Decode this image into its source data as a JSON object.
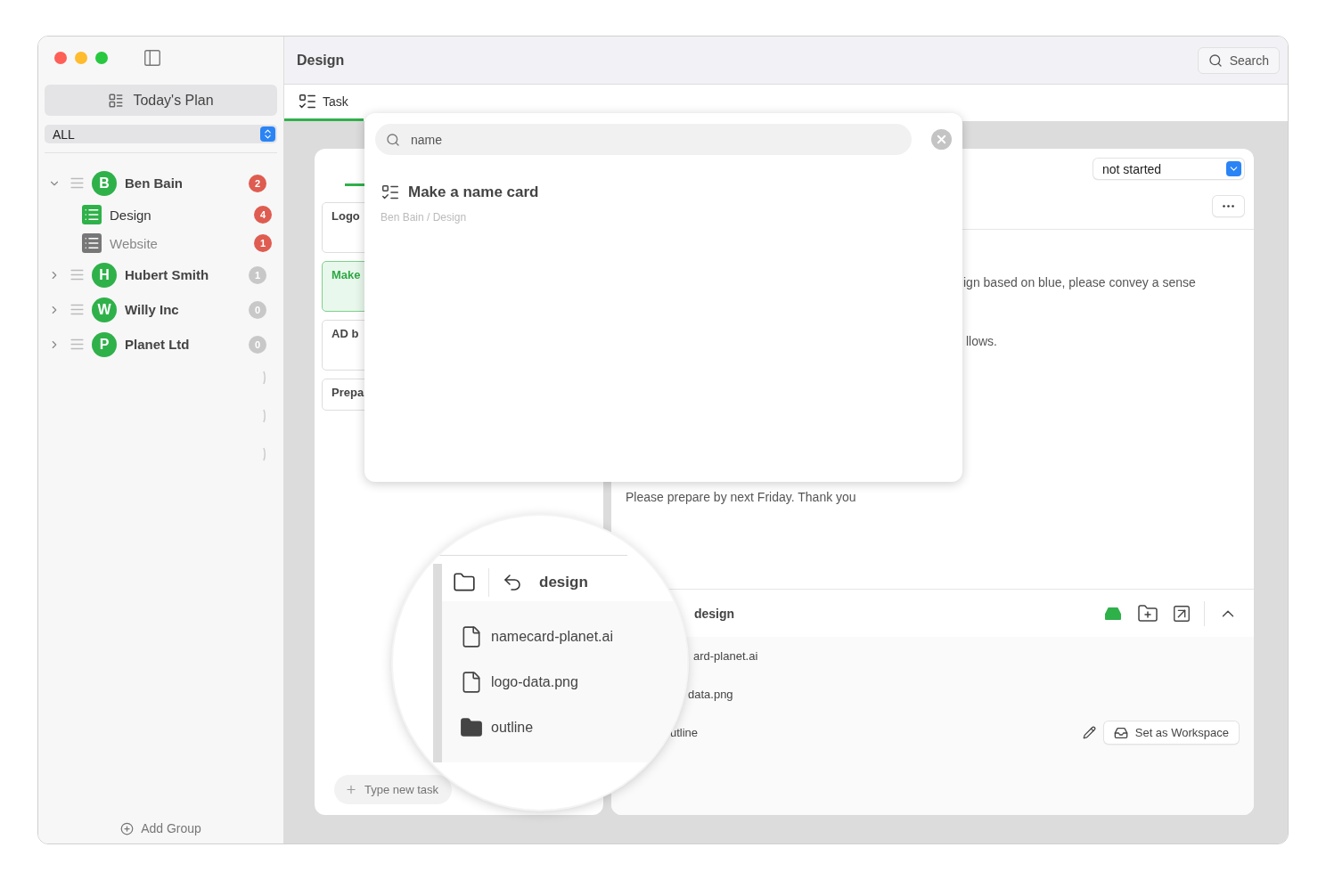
{
  "window": {
    "title": "Design",
    "search_button": "Search"
  },
  "sidebar": {
    "today_button": "Today's Plan",
    "filter": "ALL",
    "groups": [
      {
        "initial": "B",
        "name": "Ben Bain",
        "count": "2",
        "alert": true,
        "expanded": true,
        "children": [
          {
            "name": "Design",
            "count": "4",
            "selected": true
          },
          {
            "name": "Website",
            "count": "1",
            "selected": false
          }
        ]
      },
      {
        "initial": "H",
        "name": "Hubert Smith",
        "count": "1",
        "alert": false,
        "expanded": false
      },
      {
        "initial": "W",
        "name": "Willy Inc",
        "count": "0",
        "alert": false,
        "expanded": false
      },
      {
        "initial": "P",
        "name": "Planet Ltd",
        "count": "0",
        "alert": false,
        "expanded": false
      }
    ],
    "add_group": "Add Group"
  },
  "tabs": [
    {
      "label": "Task",
      "selected": true
    }
  ],
  "tasks": [
    {
      "title": "Logo",
      "selected": false
    },
    {
      "title": "Make",
      "selected": true
    },
    {
      "title": "AD b",
      "selected": false
    },
    {
      "title": "Prepa",
      "selected": false
    }
  ],
  "new_task": {
    "placeholder": "Type new task"
  },
  "detail": {
    "status": "not started",
    "lines": [
      "ign based on blue, please convey a sense",
      "llows.",
      "Please prepare by next Friday. Thank you"
    ],
    "folder": {
      "name": "design",
      "files": [
        {
          "name": "ard-planet.ai"
        },
        {
          "name": "data.png"
        },
        {
          "name": "utline",
          "action": "Set as Workspace"
        }
      ]
    }
  },
  "search_popup": {
    "query": "name",
    "results": [
      {
        "title": "Make a name card",
        "path": "Ben Bain / Design"
      }
    ]
  },
  "magnifier": {
    "folder": "design",
    "files": [
      {
        "name": "namecard-planet.ai",
        "kind": "file"
      },
      {
        "name": "logo-data.png",
        "kind": "file"
      },
      {
        "name": "outline",
        "kind": "folder"
      }
    ]
  }
}
